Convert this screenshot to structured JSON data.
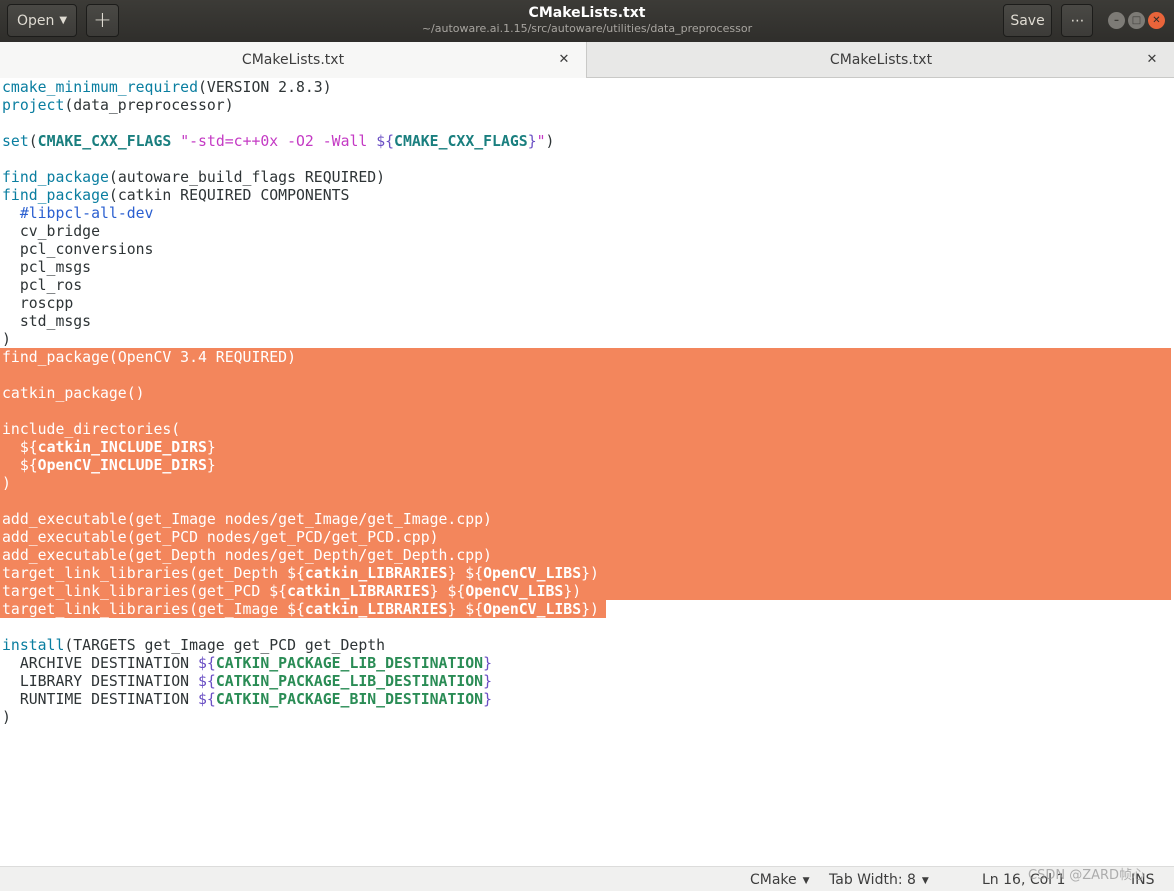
{
  "header": {
    "open_label": "Open",
    "save_label": "Save",
    "title": "CMakeLists.txt",
    "subtitle": "~/autoware.ai.1.15/src/autoware/utilities/data_preprocessor"
  },
  "tabs": [
    {
      "label": "CMakeLists.txt",
      "active": true
    },
    {
      "label": "CMakeLists.txt",
      "active": false
    }
  ],
  "editor": {
    "language": "CMake",
    "lines": [
      "cmake_minimum_required(VERSION 2.8.3)",
      "project(data_preprocessor)",
      "",
      "set(CMAKE_CXX_FLAGS \"-std=c++0x -O2 -Wall ${CMAKE_CXX_FLAGS}\")",
      "",
      "find_package(autoware_build_flags REQUIRED)",
      "find_package(catkin REQUIRED COMPONENTS",
      "  #libpcl-all-dev",
      "  cv_bridge",
      "  pcl_conversions",
      "  pcl_msgs",
      "  pcl_ros",
      "  roscpp",
      "  std_msgs",
      ")",
      "find_package(OpenCV 3.4 REQUIRED)",
      "",
      "catkin_package()",
      "",
      "include_directories(",
      "  ${catkin_INCLUDE_DIRS}",
      "  ${OpenCV_INCLUDE_DIRS}",
      ")",
      "",
      "add_executable(get_Image nodes/get_Image/get_Image.cpp)",
      "add_executable(get_PCD nodes/get_PCD/get_PCD.cpp)",
      "add_executable(get_Depth nodes/get_Depth/get_Depth.cpp)",
      "target_link_libraries(get_Depth ${catkin_LIBRARIES} ${OpenCV_LIBS})",
      "target_link_libraries(get_PCD ${catkin_LIBRARIES} ${OpenCV_LIBS})",
      "target_link_libraries(get_Image ${catkin_LIBRARIES} ${OpenCV_LIBS})",
      "",
      "install(TARGETS get_Image get_PCD get_Depth",
      "  ARCHIVE DESTINATION ${CATKIN_PACKAGE_LIB_DESTINATION}",
      "  LIBRARY DESTINATION ${CATKIN_PACKAGE_LIB_DESTINATION}",
      "  RUNTIME DESTINATION ${CATKIN_PACKAGE_BIN_DESTINATION}",
      ")"
    ],
    "selection_color": "#f3865c"
  },
  "status": {
    "language": "CMake",
    "tab_width": "Tab Width: 8",
    "position": "Ln 16, Col 1",
    "mode": "INS"
  },
  "watermark": "CSDN @ZARD帧心",
  "colors": {
    "headerbar": "#3c3b37",
    "close_button": "#e9643a",
    "keyword": "#0a7ea0",
    "string": "#c43ac4"
  }
}
